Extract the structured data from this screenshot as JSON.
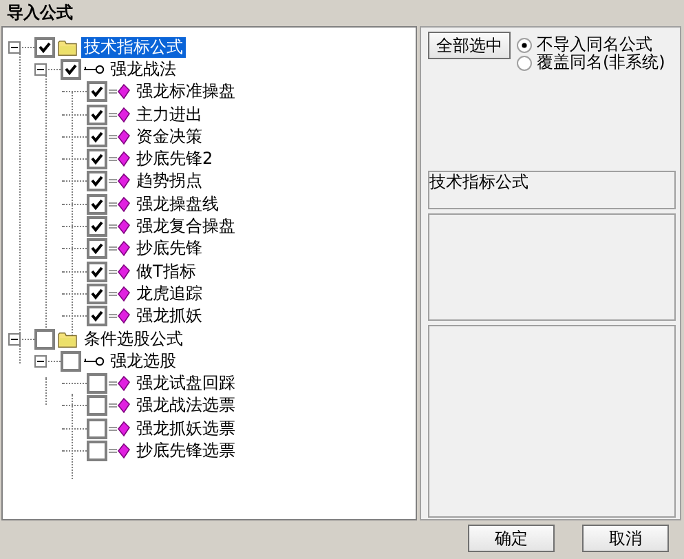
{
  "window": {
    "title": "导入公式"
  },
  "tree": [
    {
      "kind": "folder",
      "label": "技术指标公式",
      "checked": true,
      "selected": true,
      "expanded": true,
      "children": [
        {
          "kind": "group",
          "label": "强龙战法",
          "checked": true,
          "selected": false,
          "expanded": true,
          "children": [
            {
              "kind": "formula",
              "label": "强龙标准操盘",
              "checked": true,
              "selected": false
            },
            {
              "kind": "formula",
              "label": "主力进出",
              "checked": true,
              "selected": false
            },
            {
              "kind": "formula",
              "label": "资金决策",
              "checked": true,
              "selected": false
            },
            {
              "kind": "formula",
              "label": "抄底先锋2",
              "checked": true,
              "selected": false
            },
            {
              "kind": "formula",
              "label": "趋势拐点",
              "checked": true,
              "selected": false
            },
            {
              "kind": "formula",
              "label": "强龙操盘线",
              "checked": true,
              "selected": false
            },
            {
              "kind": "formula",
              "label": "强龙复合操盘",
              "checked": true,
              "selected": false
            },
            {
              "kind": "formula",
              "label": "抄底先锋",
              "checked": true,
              "selected": false
            },
            {
              "kind": "formula",
              "label": "做T指标",
              "checked": true,
              "selected": false
            },
            {
              "kind": "formula",
              "label": "龙虎追踪",
              "checked": true,
              "selected": false
            },
            {
              "kind": "formula",
              "label": "强龙抓妖",
              "checked": true,
              "selected": false
            }
          ]
        }
      ]
    },
    {
      "kind": "folder",
      "label": "条件选股公式",
      "checked": false,
      "selected": false,
      "expanded": true,
      "children": [
        {
          "kind": "group",
          "label": "强龙选股",
          "checked": false,
          "selected": false,
          "expanded": true,
          "children": [
            {
              "kind": "formula",
              "label": "强龙试盘回踩",
              "checked": false,
              "selected": false
            },
            {
              "kind": "formula",
              "label": "强龙战法选票",
              "checked": false,
              "selected": false
            },
            {
              "kind": "formula",
              "label": "强龙抓妖选票",
              "checked": false,
              "selected": false
            },
            {
              "kind": "formula",
              "label": "抄底先锋选票",
              "checked": false,
              "selected": false
            }
          ]
        }
      ]
    }
  ],
  "select_all_button": "全部选中",
  "options": [
    {
      "label": "不导入同名公式",
      "selected": true
    },
    {
      "label": "覆盖同名(非系统)",
      "selected": false
    }
  ],
  "category_field": {
    "value": "技术指标公式"
  },
  "buttons": [
    "确定",
    "取消"
  ]
}
